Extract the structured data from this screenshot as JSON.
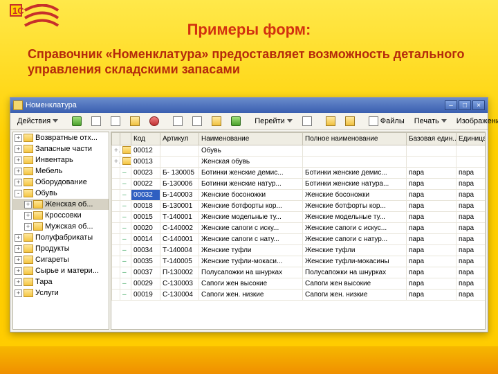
{
  "slide": {
    "title": "Примеры форм:",
    "subtitle": "Справочник «Номенклатура» предоставляет возможность детального управления складскими запасами"
  },
  "window": {
    "title": "Номенклатура"
  },
  "toolbar": {
    "actions": "Действия",
    "goto": "Перейти",
    "files": "Файлы",
    "print": "Печать",
    "image": "Изображение"
  },
  "tree": [
    {
      "lvl": 1,
      "pm": "+",
      "label": "Возвратные отх..."
    },
    {
      "lvl": 1,
      "pm": "+",
      "label": "Запасные части"
    },
    {
      "lvl": 1,
      "pm": "+",
      "label": "Инвентарь"
    },
    {
      "lvl": 1,
      "pm": "+",
      "label": "Мебель"
    },
    {
      "lvl": 1,
      "pm": "+",
      "label": "Оборудование"
    },
    {
      "lvl": 1,
      "pm": "-",
      "label": "Обувь"
    },
    {
      "lvl": 2,
      "pm": "+",
      "label": "Женская об...",
      "sel": true
    },
    {
      "lvl": 2,
      "pm": "+",
      "label": "Кроссовки"
    },
    {
      "lvl": 2,
      "pm": "+",
      "label": "Мужская об..."
    },
    {
      "lvl": 1,
      "pm": "+",
      "label": "Полуфабрикаты"
    },
    {
      "lvl": 1,
      "pm": "+",
      "label": "Продукты"
    },
    {
      "lvl": 1,
      "pm": "+",
      "label": "Сигареты"
    },
    {
      "lvl": 1,
      "pm": "+",
      "label": "Сырье и матери..."
    },
    {
      "lvl": 1,
      "pm": "+",
      "label": "Тара"
    },
    {
      "lvl": 1,
      "pm": "+",
      "label": "Услуги"
    }
  ],
  "columns": {
    "code": "Код",
    "article": "Артикул",
    "name": "Наименование",
    "full": "Полное наименование",
    "base": "Базовая един...",
    "unit": "Единица хра..."
  },
  "rows": [
    {
      "mark": "+",
      "fold": true,
      "code": "00012",
      "art": "",
      "name": "Обувь",
      "full": "",
      "base": "",
      "unit": ""
    },
    {
      "mark": "+",
      "fold": true,
      "code": "00013",
      "art": "",
      "name": "Женская обувь",
      "full": "",
      "base": "",
      "unit": ""
    },
    {
      "mark": "",
      "fold": false,
      "code": "00023",
      "art": "Б- 130005",
      "name": "Ботинки женские демис...",
      "full": "Ботинки женские демис...",
      "base": "пара",
      "unit": "пара"
    },
    {
      "mark": "",
      "fold": false,
      "code": "00022",
      "art": "Б-130006",
      "name": "Ботинки женские натур...",
      "full": "Ботинки женские натура...",
      "base": "пара",
      "unit": "пара"
    },
    {
      "mark": "",
      "fold": false,
      "code": "00032",
      "art": "Б-140003",
      "name": "Женские босоножки",
      "full": "Женские босоножки",
      "base": "пара",
      "unit": "пара",
      "sel": true
    },
    {
      "mark": "",
      "fold": false,
      "code": "00018",
      "art": "Б-130001",
      "name": "Женские ботфорты кор...",
      "full": "Женские ботфорты кор...",
      "base": "пара",
      "unit": "пара"
    },
    {
      "mark": "",
      "fold": false,
      "code": "00015",
      "art": "Т-140001",
      "name": "Женские модельные ту...",
      "full": "Женские модельные ту...",
      "base": "пара",
      "unit": "пара"
    },
    {
      "mark": "",
      "fold": false,
      "code": "00020",
      "art": "С-140002",
      "name": "Женские сапоги с иску...",
      "full": "Женские сапоги с искус...",
      "base": "пара",
      "unit": "пара"
    },
    {
      "mark": "",
      "fold": false,
      "code": "00014",
      "art": "С-140001",
      "name": "Женские сапоги с нату...",
      "full": "Женские сапоги с натур...",
      "base": "пара",
      "unit": "пара"
    },
    {
      "mark": "",
      "fold": false,
      "code": "00034",
      "art": "Т-140004",
      "name": "Женские туфли",
      "full": "Женские туфли",
      "base": "пара",
      "unit": "пара"
    },
    {
      "mark": "",
      "fold": false,
      "code": "00035",
      "art": "Т-140005",
      "name": "Женские туфли-мокаси...",
      "full": "Женские туфли-мокасины",
      "base": "пара",
      "unit": "пара"
    },
    {
      "mark": "",
      "fold": false,
      "code": "00037",
      "art": "П-130002",
      "name": "Полусапожки на шнурках",
      "full": "Полусапожки на шнурках",
      "base": "пара",
      "unit": "пара"
    },
    {
      "mark": "",
      "fold": false,
      "code": "00029",
      "art": "С-130003",
      "name": "Сапоги жен высокие",
      "full": "Сапоги жен высокие",
      "base": "пара",
      "unit": "пара"
    },
    {
      "mark": "",
      "fold": false,
      "code": "00019",
      "art": "С-130004",
      "name": "Сапоги жен. низкие",
      "full": "Сапоги жен. низкие",
      "base": "пара",
      "unit": "пара"
    }
  ]
}
